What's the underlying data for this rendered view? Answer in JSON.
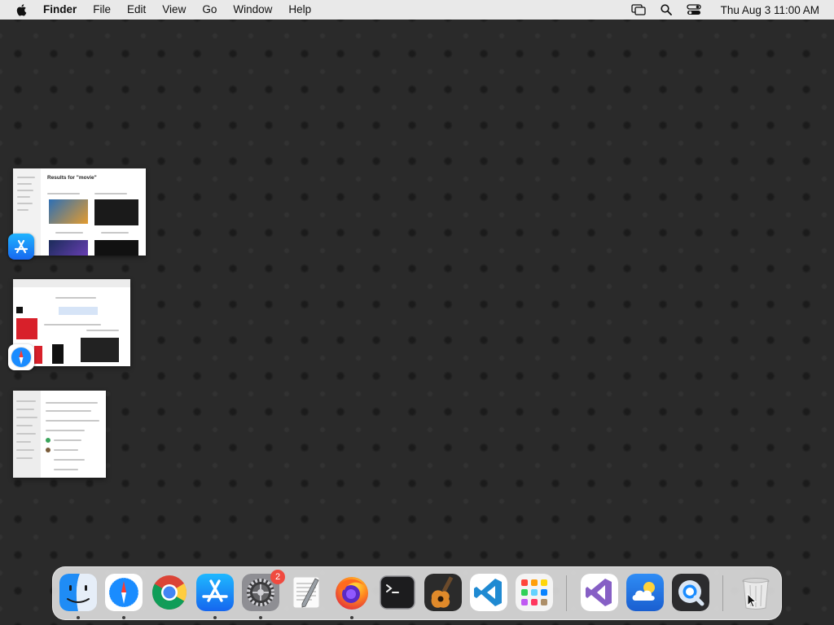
{
  "menubar": {
    "app_name": "Finder",
    "menus": [
      "File",
      "Edit",
      "View",
      "Go",
      "Window",
      "Help"
    ],
    "status_icons": [
      "screen-mirroring-icon",
      "spotlight-search-icon",
      "control-center-icon"
    ],
    "clock": "Thu Aug 3  11:00 AM"
  },
  "windows": [
    {
      "app": "App Store",
      "icon": "app-store-icon",
      "title": "Results for \"movie\""
    },
    {
      "app": "Safari",
      "icon": "safari-icon"
    },
    {
      "app": "System Settings",
      "icon": "system-settings-icon"
    }
  ],
  "dock": {
    "items": [
      {
        "name": "Finder",
        "icon": "finder-icon",
        "running": true
      },
      {
        "name": "Safari",
        "icon": "safari-icon",
        "running": true
      },
      {
        "name": "Google Chrome",
        "icon": "chrome-icon",
        "running": false
      },
      {
        "name": "App Store",
        "icon": "app-store-icon",
        "running": true
      },
      {
        "name": "System Settings",
        "icon": "system-settings-icon",
        "running": true,
        "badge": "2"
      },
      {
        "name": "TextEdit",
        "icon": "textedit-icon",
        "running": false
      },
      {
        "name": "Firefox",
        "icon": "firefox-icon",
        "running": true
      },
      {
        "name": "Terminal",
        "icon": "terminal-icon",
        "running": false
      },
      {
        "name": "GarageBand",
        "icon": "garageband-icon",
        "running": false
      },
      {
        "name": "Visual Studio Code",
        "icon": "vscode-icon",
        "running": false
      },
      {
        "name": "Launchpad",
        "icon": "launchpad-icon",
        "running": false
      },
      {
        "name": "Visual Studio",
        "icon": "visual-studio-icon",
        "running": false
      },
      {
        "name": "Weather",
        "icon": "weather-icon",
        "running": false
      },
      {
        "name": "QuickTime Player",
        "icon": "quicktime-icon",
        "running": false
      },
      {
        "name": "Trash",
        "icon": "trash-icon",
        "running": false
      }
    ]
  },
  "colors": {
    "desktop": "#2a2a2a",
    "menubar": "#e9e9e9",
    "badge": "#f04a3f",
    "accent_blue": "#1a8cff"
  }
}
